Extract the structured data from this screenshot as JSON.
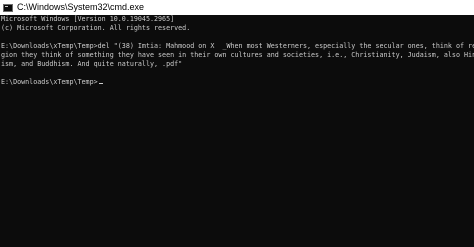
{
  "window": {
    "title": "C:\\Windows\\System32\\cmd.exe",
    "icon": "console-icon"
  },
  "console": {
    "header_lines": [
      "Microsoft Windows [Version 10.0.19045.2965]",
      "(c) Microsoft Corporation. All rights reserved."
    ],
    "command_lines": [
      "E:\\Downloads\\xTemp\\Temp>del \"(38) Imtia: Mahmood on X  _When most Westerners, especially the secular ones, think of reli",
      "gion they think of something they have seen in their own cultures and societies, i.e., Christianity, Judaism, also Hindu",
      "ism, and Buddhism. And quite naturally, .pdf\""
    ],
    "prompt": "E:\\Downloads\\xTemp\\Temp>",
    "colors": {
      "background": "#0c0c0c",
      "text": "#cccccc"
    }
  }
}
